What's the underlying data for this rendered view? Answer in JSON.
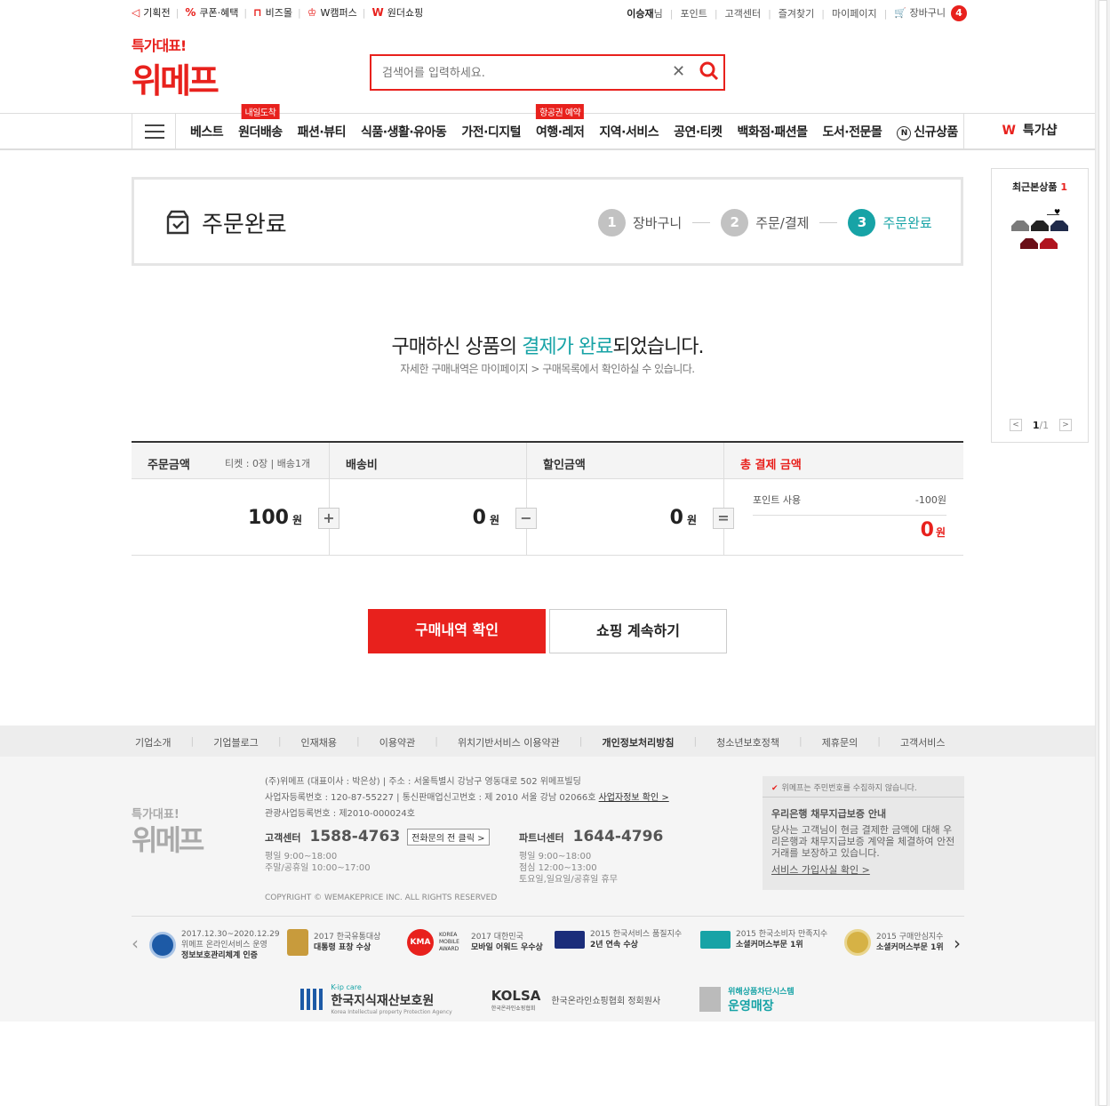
{
  "topbar": {
    "links": [
      "기획전",
      "쿠폰·혜택",
      "비즈몰",
      "W캠퍼스",
      "원더쇼핑"
    ],
    "user": {
      "name": "이승재",
      "suffix": "님"
    },
    "menu": [
      "포인트",
      "고객센터",
      "즐겨찾기",
      "마이페이지"
    ],
    "cart_label": "장바구니",
    "cart_count": "4"
  },
  "logo": {
    "slogan": "특가대표!",
    "brand": "위메프"
  },
  "search": {
    "placeholder": "검색어를 입력하세요."
  },
  "nav": {
    "items": [
      "베스트",
      "원더배송",
      "패션·뷰티",
      "식품·생활·유아동",
      "가전·디지털",
      "여행·레저",
      "지역·서비스",
      "공연·티켓",
      "백화점·패션몰",
      "도서·전문몰",
      "신규상품"
    ],
    "badge_wonder": "내일도착",
    "badge_travel": "항공권 예약",
    "new_icon": "N",
    "special_w": "W",
    "special_label": "특가샵"
  },
  "recent": {
    "title": "최근본상품",
    "count": "1",
    "page_current": "1",
    "page_total": "/1"
  },
  "order": {
    "title": "주문완료",
    "steps": [
      {
        "num": "1",
        "label": "장바구니"
      },
      {
        "num": "2",
        "label": "주문/결제"
      },
      {
        "num": "3",
        "label": "주문완료"
      }
    ]
  },
  "message": {
    "line1_a": "구매하신 상품의 ",
    "line1_hl": "결제가 완료",
    "line1_b": "되었습니다.",
    "line2": "자세한 구매내역은 마이페이지 > 구매목록에서 확인하실 수 있습니다."
  },
  "summary": {
    "order_amount_label": "주문금액",
    "ticket_info": "티켓 : 0장  |  배송1개",
    "order_amount": "100",
    "shipping_label": "배송비",
    "shipping": "0",
    "discount_label": "할인금액",
    "discount": "0",
    "total_label": "총 결제 금액",
    "point_label": "포인트 사용",
    "point_value": "-100원",
    "total": "0",
    "won": "원",
    "op_plus": "+",
    "op_minus": "−",
    "op_equal": "="
  },
  "buttons": {
    "primary": "구매내역 확인",
    "secondary": "쇼핑 계속하기"
  },
  "footer": {
    "links": [
      "기업소개",
      "기업블로그",
      "인재채용",
      "이용약관",
      "위치기반서비스 이용약관",
      "개인정보처리방침",
      "청소년보호정책",
      "제휴문의",
      "고객서비스"
    ],
    "logo_slogan": "특가대표!",
    "logo_brand": "위메프",
    "info1": "(주)위메프 (대표이사 : 박은상)  |  주소 : 서울특별시 강남구 영동대로 502 위메프빌딩",
    "info2": "사업자등록번호 : 120-87-55227  |  통신판매업신고번호 : 제 2010 서울 강남 02066호",
    "info2_link": "사업자정보 확인 >",
    "info3": "관광사업등록번호 : 제2010-000024호",
    "cs_label": "고객센터",
    "cs_number": "1588-4763",
    "cs_button": "전화문의 전 클릭 >",
    "cs_hours1": "평일 9:00~18:00",
    "cs_hours2": "주말/공휴일 10:00~17:00",
    "partner_label": "파트너센터",
    "partner_number": "1644-4796",
    "partner_hours1": "평일 9:00~18:00",
    "partner_hours2": "점심 12:00~13:00",
    "partner_hours3": "토요일,일요일/공휴일 휴무",
    "copyright": "COPYRIGHT © WEMAKEPRICE INC. ALL RIGHTS RESERVED",
    "notice_top": "위메프는 주민번호를 수집하지 않습니다.",
    "notice_title": "우리은행 채무지급보증 안내",
    "notice_body": "당사는 고객님이 현금 결제한 금액에 대해 우리은행과 채무지급보증 계약을 체결하여 안전거래를 보장하고 있습니다.",
    "notice_link": "서비스 가입사실 확인 >",
    "awards": [
      {
        "l1": "2017.12.30~2020.12.29",
        "l2": "위메프 온라인서비스 운영",
        "l3": "정보보호관리체계 인증"
      },
      {
        "l1": "2017 한국유통대상",
        "l2": "대통령 표창 수상",
        "l3": ""
      },
      {
        "l1": "2017 대한민국",
        "l2": "모바일 어워드 우수상",
        "l3": ""
      },
      {
        "l1": "2015 한국서비스 품질지수",
        "l2": "2년 연속 수상",
        "l3": ""
      },
      {
        "l1": "2015 한국소비자 만족지수",
        "l2": "소셜커머스부문 1위",
        "l3": ""
      },
      {
        "l1": "2015 구매안심지수",
        "l2": "소셜커머스부문 1위",
        "l3": ""
      }
    ],
    "kma_logo": "KMA",
    "kma_text": "KOREA MOBILE AWARD",
    "partner1_small": "K-ip care",
    "partner1_big": "한국지식재산보호원",
    "partner1_sub": "Korea Intellectual property Protection Agency",
    "partner2_big": "KOLSA",
    "partner2_small": "한국온라인쇼핑협회",
    "partner2_text": "한국온라인쇼핑협회 정회원사",
    "partner3_small": "위해상품차단시스템",
    "partner3_big": "운영매장"
  },
  "colors": {
    "brand": "#e8211d",
    "accent": "#17a3a6"
  }
}
